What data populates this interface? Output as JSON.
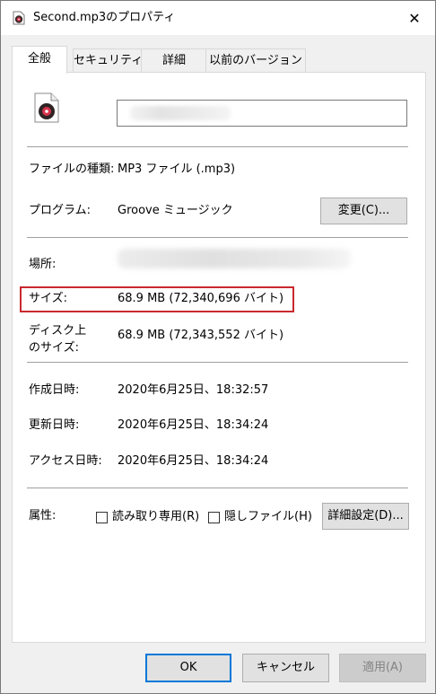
{
  "window": {
    "title": "Second.mp3のプロパティ",
    "close_glyph": "✕"
  },
  "tabs": [
    {
      "label": "全般",
      "active": true
    },
    {
      "label": "セキュリティ",
      "active": false
    },
    {
      "label": "詳細",
      "active": false
    },
    {
      "label": "以前のバージョン",
      "active": false
    }
  ],
  "general": {
    "file_name_value": "",
    "file_type": {
      "label": "ファイルの種類:",
      "value": "MP3 ファイル (.mp3)"
    },
    "program": {
      "label": "プログラム:",
      "value": "Groove ミュージック",
      "change_button": "変更(C)..."
    },
    "location": {
      "label": "場所:",
      "value": ""
    },
    "size": {
      "label": "サイズ:",
      "value": "68.9 MB (72,340,696 バイト)"
    },
    "size_on_disk": {
      "label_line1": "ディスク上",
      "label_line2": "のサイズ:",
      "value": "68.9 MB (72,343,552 バイト)"
    },
    "created": {
      "label": "作成日時:",
      "value": "2020年6月25日、18:32:57"
    },
    "modified": {
      "label": "更新日時:",
      "value": "2020年6月25日、18:34:24"
    },
    "accessed": {
      "label": "アクセス日時:",
      "value": "2020年6月25日、18:34:24"
    },
    "attributes": {
      "label": "属性:",
      "read_only": {
        "label": "読み取り専用(R)",
        "checked": false
      },
      "hidden": {
        "label": "隠しファイル(H)",
        "checked": false
      },
      "advanced_button": "詳細設定(D)..."
    }
  },
  "footer": {
    "ok": "OK",
    "cancel": "キャンセル",
    "apply": "適用(A)"
  },
  "colors": {
    "highlight_border": "#c8292e",
    "default_button_border": "#0078d7",
    "icon_accent": "#d6334b"
  },
  "icons": {
    "title_icon": "audio-file-icon",
    "file_icon": "audio-file-icon"
  }
}
